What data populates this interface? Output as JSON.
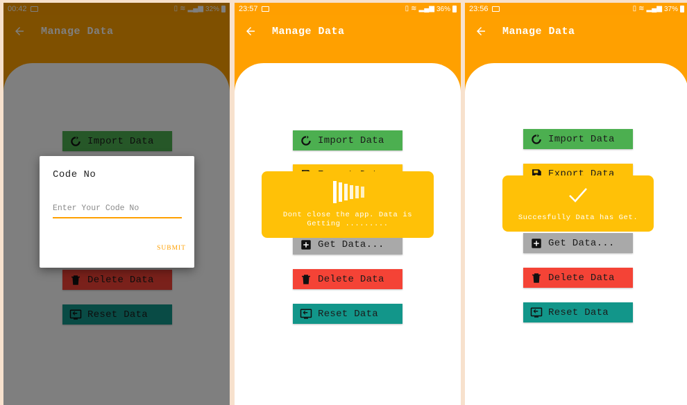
{
  "colors": {
    "accent": "#ffa000",
    "import": "#4caf50",
    "export": "#ffc107",
    "get": "#a9a9a9",
    "delete": "#f44336",
    "reset": "#12968a"
  },
  "screens": [
    {
      "status": {
        "time": "00:42",
        "battery": "32%"
      },
      "appbar": {
        "title": "Manage Data",
        "back_icon": "arrow-back-icon"
      },
      "buttons": {
        "import": "Import Data",
        "delete": "Delete Data",
        "reset": "Reset  Data"
      },
      "dialog": {
        "title": "Code No",
        "input_placeholder": "Enter Your Code No",
        "submit": "SUBMIT"
      }
    },
    {
      "status": {
        "time": "23:57",
        "battery": "36%"
      },
      "appbar": {
        "title": "Manage Data",
        "back_icon": "arrow-back-icon"
      },
      "buttons": {
        "import": "Import Data",
        "export": "Export Data",
        "get": "Get Data...",
        "delete": "Delete Data",
        "reset": "Reset  Data"
      },
      "toast": {
        "icon": "loading-bars-icon",
        "line1": "Dont close the app. Data is",
        "line2": "Getting ........."
      }
    },
    {
      "status": {
        "time": "23:56",
        "battery": "37%"
      },
      "appbar": {
        "title": "Manage Data",
        "back_icon": "arrow-back-icon"
      },
      "buttons": {
        "import": "Import Data",
        "export": "Export Data",
        "get": "Get Data...",
        "delete": "Delete Data",
        "reset": "Reset  Data"
      },
      "toast": {
        "icon": "checkmark-icon",
        "line1": "Succesfully Data has Get."
      }
    }
  ]
}
